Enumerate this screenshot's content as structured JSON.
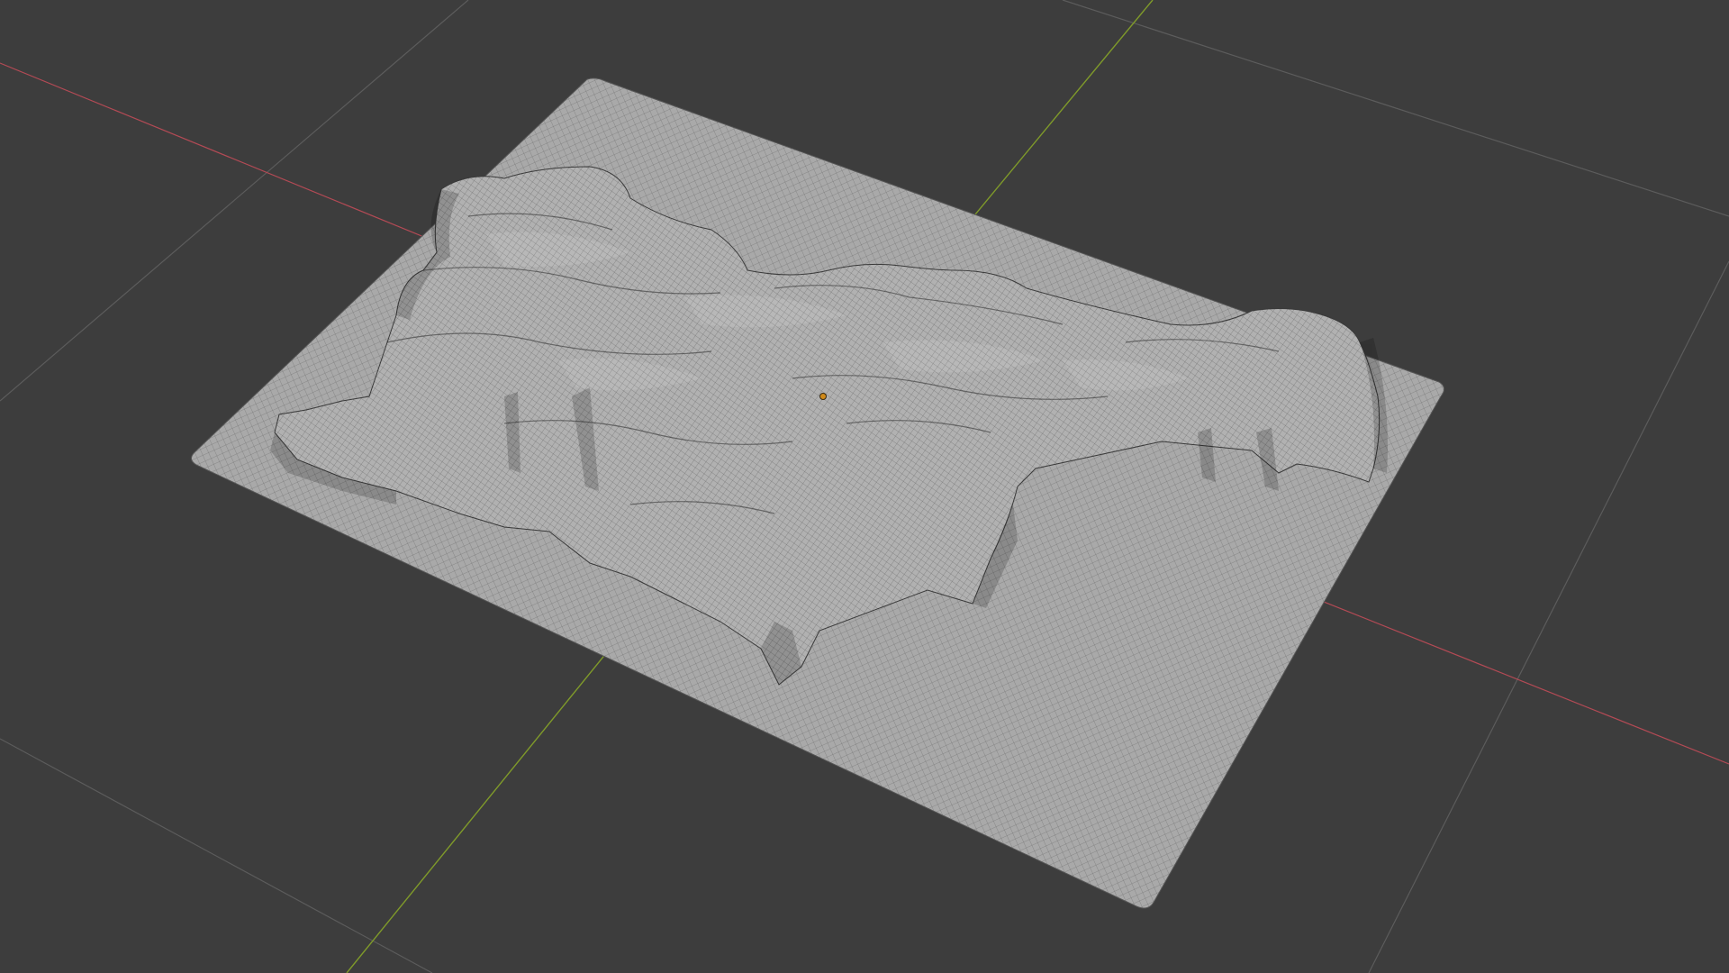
{
  "app": {
    "view": "3D Viewport",
    "shading": "wireframe-over-solid",
    "object": "terrain-mesh"
  },
  "colors": {
    "background": "#3d3d3d",
    "grid_line": "#5a5a5a",
    "axis_x": "#b34a55",
    "axis_y": "#7f9a2a",
    "mesh_fill": "#a8a8a8",
    "mesh_wire": "#2a2a2a",
    "origin_dot": "#d08a1a"
  },
  "icons": {
    "origin": "object-origin-icon"
  }
}
